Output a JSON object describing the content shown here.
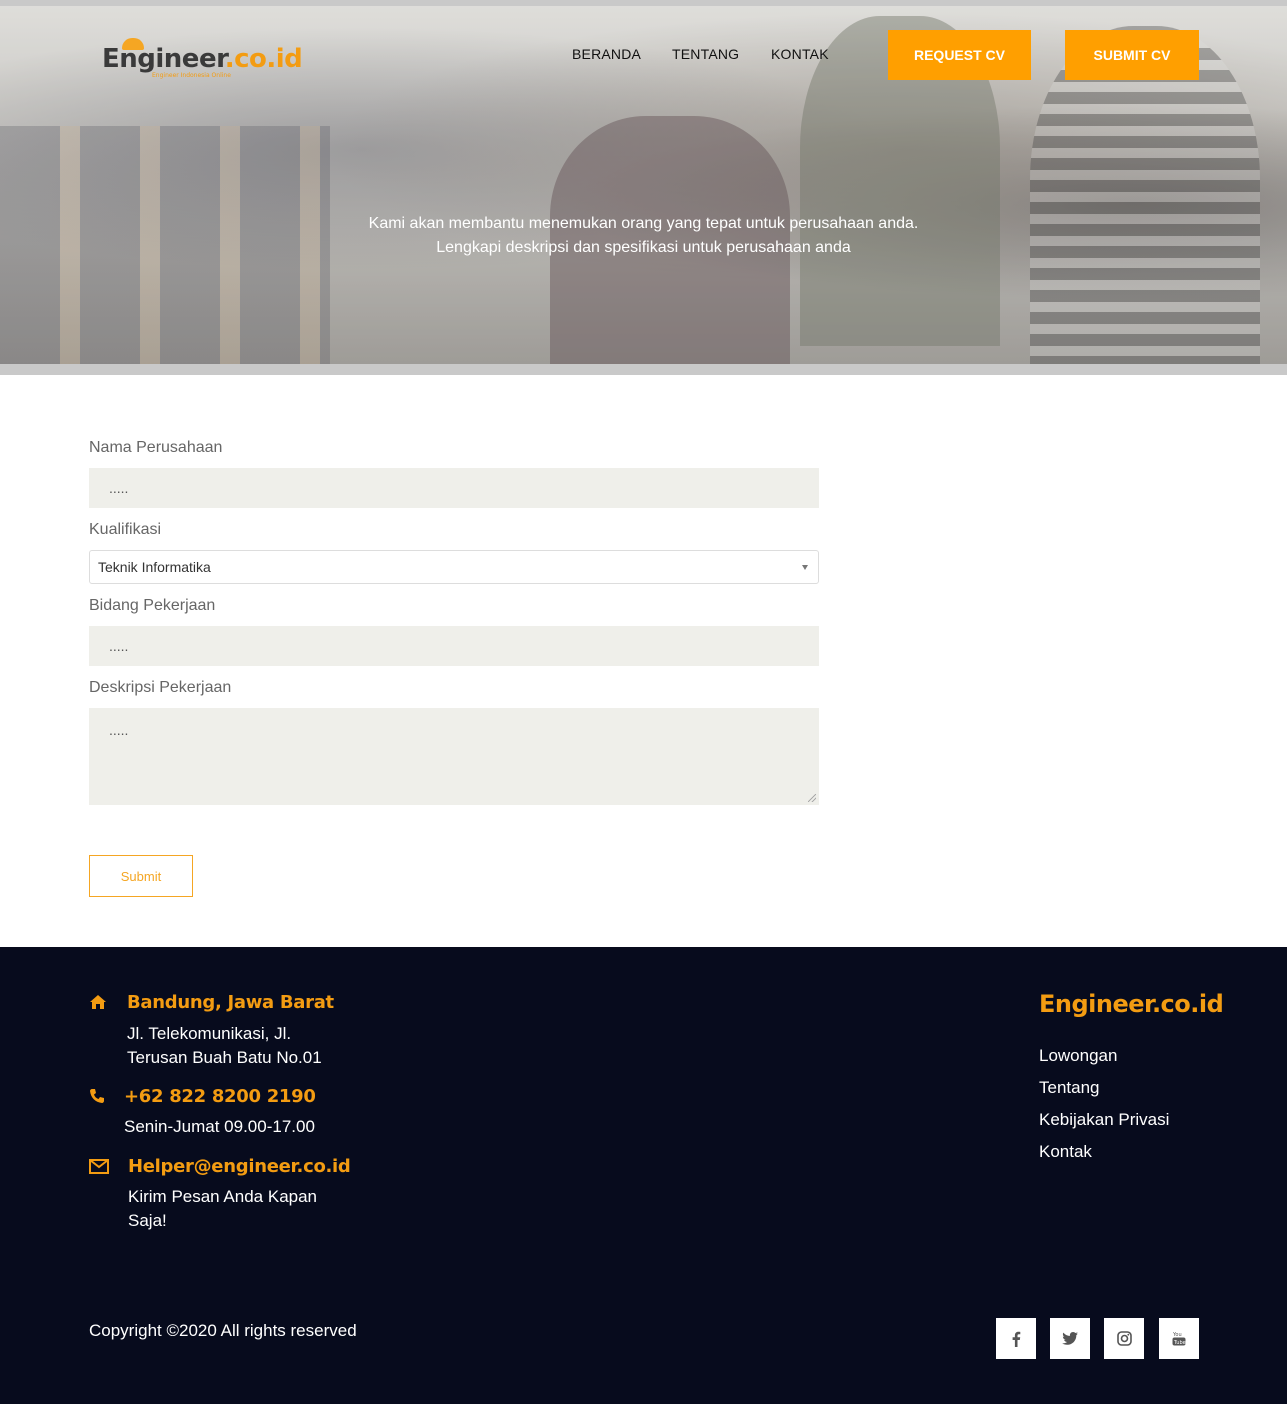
{
  "header": {
    "logo_text": "Engineer",
    "logo_accent": ".co.id",
    "logo_tagline": "Engineer Indonesia Online",
    "nav": [
      "BERANDA",
      "TENTANG",
      "KONTAK"
    ],
    "request_cv": "REQUEST CV",
    "submit_cv": "SUBMIT CV"
  },
  "hero": {
    "text": "Kami akan membantu menemukan orang yang tepat untuk perusahaan anda. Lengkapi deskripsi dan spesifikasi untuk perusahaan anda"
  },
  "form": {
    "company_label": "Nama Perusahaan",
    "company_placeholder": ".....",
    "qualification_label": "Kualifikasi",
    "qualification_value": "Teknik Informatika",
    "field_label": "Bidang Pekerjaan",
    "field_placeholder": ".....",
    "desc_label": "Deskripsi Pekerjaan",
    "desc_placeholder": ".....",
    "submit": "Submit"
  },
  "footer": {
    "address_title": "Bandung, Jawa Barat",
    "address_line1": "Jl. Telekomunikasi, Jl.",
    "address_line2": "Terusan Buah Batu No.01",
    "phone": "+62 822 8200 2190",
    "hours": "Senin-Jumat 09.00-17.00",
    "email": "Helper@engineer.co.id",
    "email_note_line1": "Kirim Pesan Anda Kapan",
    "email_note_line2": "Saja!",
    "brand": "Engineer.co.id",
    "links": [
      "Lowongan",
      "Tentang",
      "Kebijakan Privasi",
      "Kontak"
    ],
    "copyright": "Copyright ©2020 All rights reserved",
    "social_icons": [
      "facebook-icon",
      "twitter-icon",
      "instagram-icon",
      "youtube-icon"
    ]
  },
  "colors": {
    "accent": "#ff9f00",
    "footer_bg": "#070b1d",
    "input_bg": "#efefea"
  }
}
